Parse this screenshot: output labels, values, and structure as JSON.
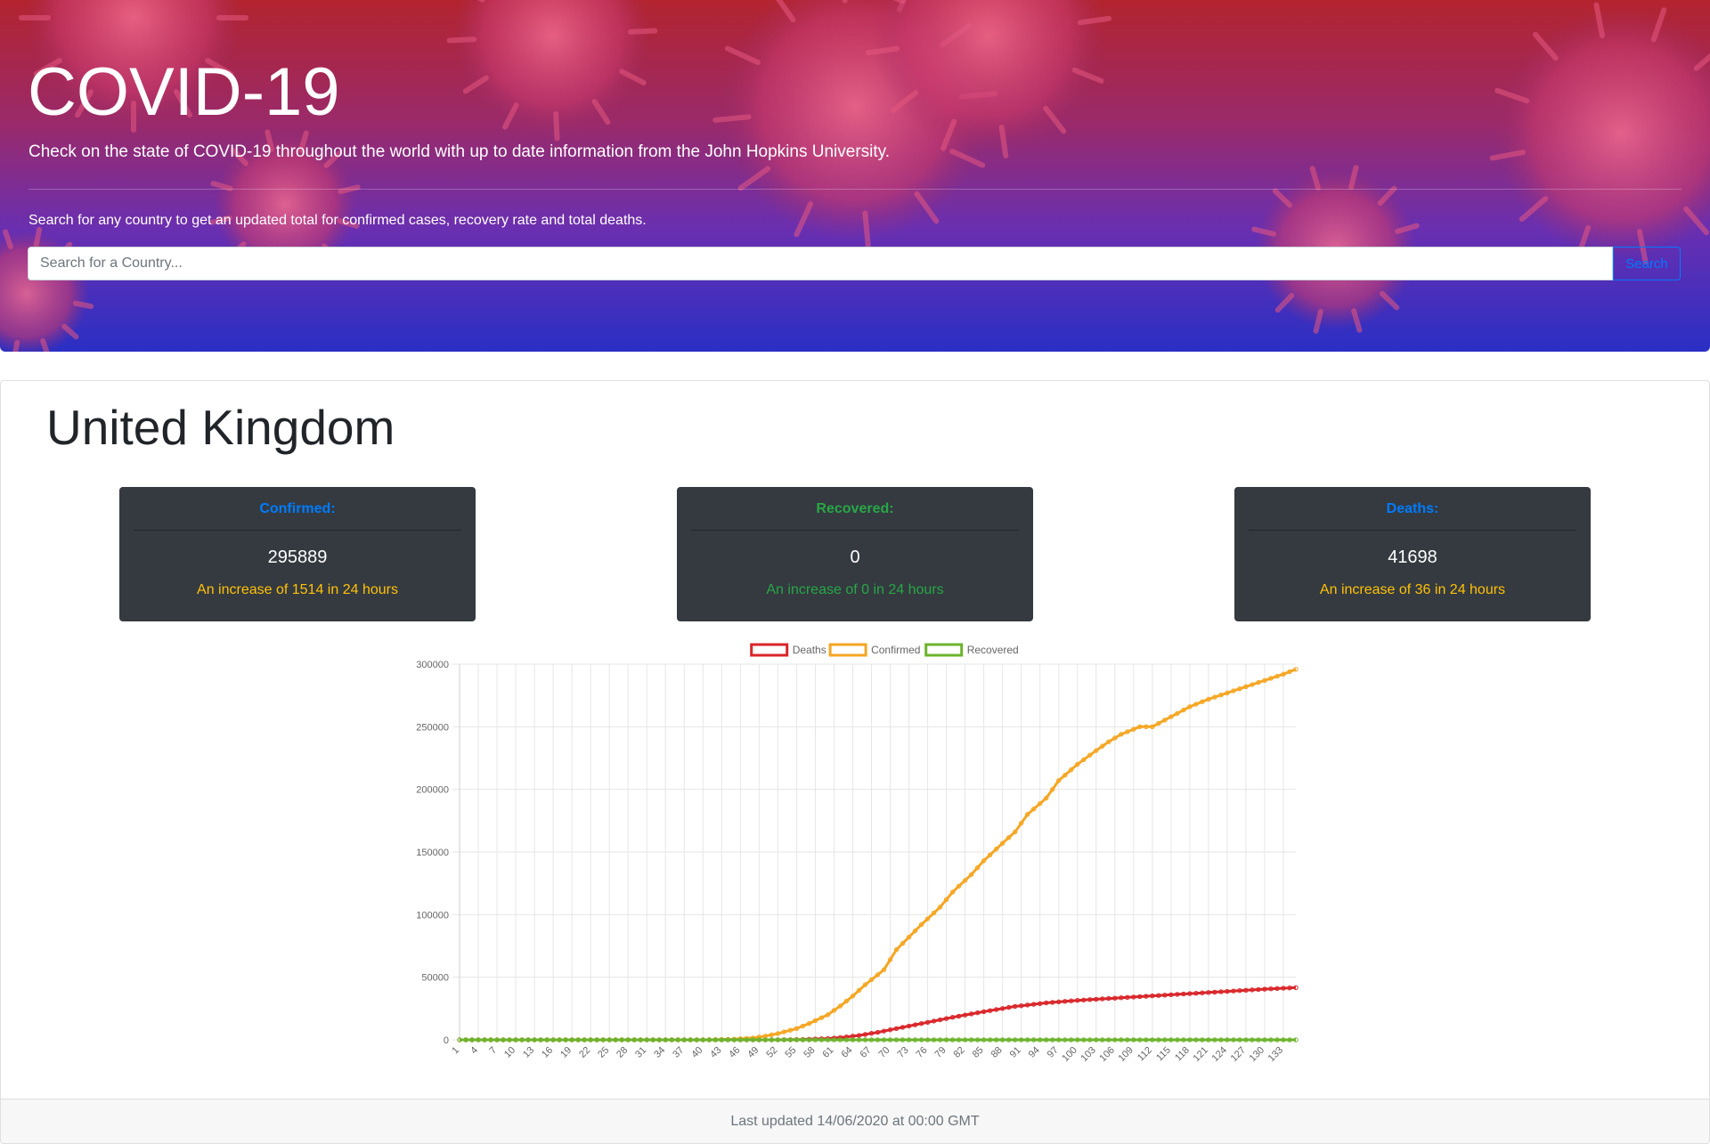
{
  "header": {
    "title": "COVID-19",
    "lead": "Check on the state of COVID-19 throughout the world with up to date information from the John Hopkins University.",
    "hint": "Search for any country to get an updated total for confirmed cases, recovery rate and total deaths."
  },
  "search": {
    "placeholder": "Search for a Country...",
    "button_label": "Search"
  },
  "country": {
    "name": "United Kingdom"
  },
  "stats": {
    "confirmed": {
      "title": "Confirmed:",
      "value": "295889",
      "delta": "An increase of 1514 in 24 hours",
      "title_color": "#007bff",
      "delta_color": "#ffc107"
    },
    "recovered": {
      "title": "Recovered:",
      "value": "0",
      "delta": "An increase of 0 in 24 hours",
      "title_color": "#28a745",
      "delta_color": "#28a745"
    },
    "deaths": {
      "title": "Deaths:",
      "value": "41698",
      "delta": "An increase of 36 in 24 hours",
      "title_color": "#007bff",
      "delta_color": "#ffc107"
    }
  },
  "footer": {
    "text": "Last updated 14/06/2020 at 00:00 GMT"
  },
  "chart_data": {
    "type": "line",
    "title": "",
    "xlabel": "",
    "ylabel": "",
    "ylim": [
      0,
      300000
    ],
    "yticks": [
      0,
      50000,
      100000,
      150000,
      200000,
      250000,
      300000
    ],
    "x_range": [
      1,
      135
    ],
    "x_tick_step": 3,
    "legend": "top",
    "grid": true,
    "series": [
      {
        "name": "Deaths",
        "color": "#d9262a",
        "points": [
          [
            1,
            0
          ],
          [
            45,
            0
          ],
          [
            52,
            10
          ],
          [
            56,
            300
          ],
          [
            60,
            1000
          ],
          [
            62,
            1800
          ],
          [
            65,
            3500
          ],
          [
            68,
            6000
          ],
          [
            70,
            8000
          ],
          [
            73,
            11000
          ],
          [
            76,
            14000
          ],
          [
            80,
            18000
          ],
          [
            85,
            22500
          ],
          [
            90,
            26700
          ],
          [
            95,
            29500
          ],
          [
            100,
            31500
          ],
          [
            105,
            33000
          ],
          [
            110,
            34500
          ],
          [
            115,
            36000
          ],
          [
            120,
            37500
          ],
          [
            125,
            39000
          ],
          [
            130,
            40500
          ],
          [
            135,
            41698
          ]
        ]
      },
      {
        "name": "Confirmed",
        "color": "#f5a623",
        "points": [
          [
            1,
            0
          ],
          [
            40,
            0
          ],
          [
            45,
            500
          ],
          [
            48,
            1500
          ],
          [
            50,
            3000
          ],
          [
            52,
            5000
          ],
          [
            55,
            9000
          ],
          [
            57,
            13000
          ],
          [
            60,
            20000
          ],
          [
            62,
            27000
          ],
          [
            64,
            35000
          ],
          [
            66,
            44000
          ],
          [
            68,
            52000
          ],
          [
            69,
            56000
          ],
          [
            70,
            64000
          ],
          [
            71,
            72000
          ],
          [
            73,
            82000
          ],
          [
            75,
            92000
          ],
          [
            78,
            106000
          ],
          [
            80,
            118000
          ],
          [
            83,
            132000
          ],
          [
            85,
            143000
          ],
          [
            88,
            157000
          ],
          [
            90,
            166000
          ],
          [
            92,
            180000
          ],
          [
            95,
            193000
          ],
          [
            97,
            207000
          ],
          [
            100,
            220000
          ],
          [
            103,
            231000
          ],
          [
            105,
            238000
          ],
          [
            107,
            244000
          ],
          [
            110,
            250000
          ],
          [
            112,
            250000
          ],
          [
            115,
            258000
          ],
          [
            118,
            266000
          ],
          [
            121,
            272000
          ],
          [
            124,
            277000
          ],
          [
            127,
            282000
          ],
          [
            130,
            287000
          ],
          [
            133,
            292000
          ],
          [
            135,
            295889
          ]
        ]
      },
      {
        "name": "Recovered",
        "color": "#6cb32c",
        "points": [
          [
            1,
            0
          ],
          [
            135,
            0
          ]
        ]
      }
    ]
  }
}
